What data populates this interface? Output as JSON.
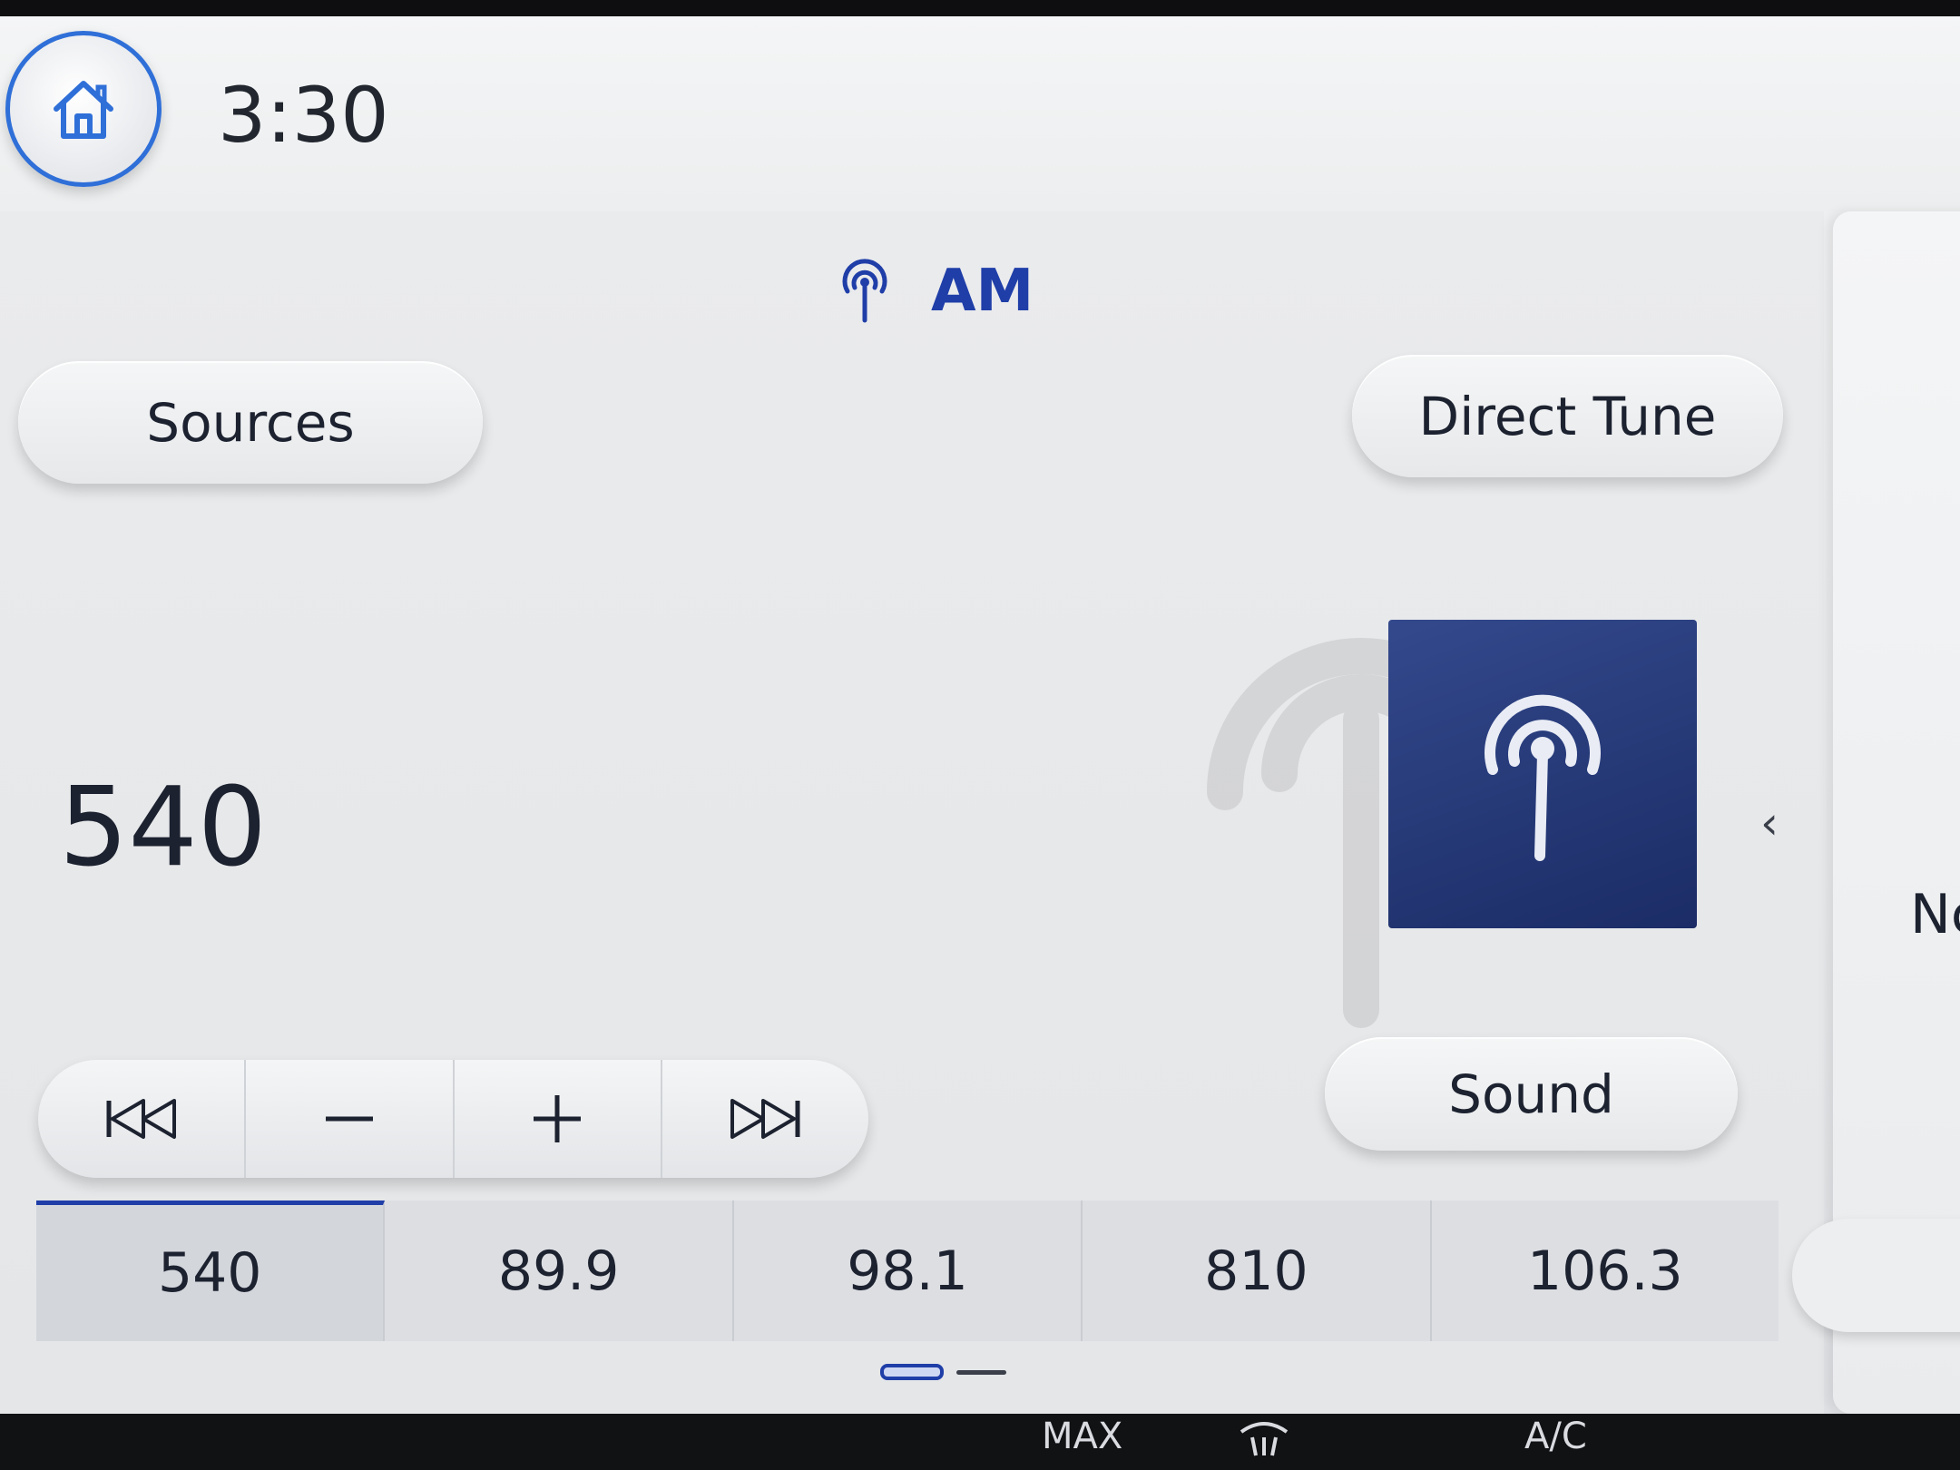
{
  "header": {
    "home_icon": "home-icon",
    "clock": "3:30"
  },
  "source": {
    "icon": "radio-antenna-icon",
    "band": "AM"
  },
  "buttons": {
    "sources": "Sources",
    "direct_tune": "Direct Tune",
    "sound": "Sound"
  },
  "station": {
    "frequency": "540"
  },
  "transport": {
    "seek_back_icon": "seek-back-icon",
    "tune_down_icon": "minus-icon",
    "tune_up_icon": "plus-icon",
    "seek_forward_icon": "seek-forward-icon"
  },
  "presets": [
    {
      "label": "540",
      "active": true
    },
    {
      "label": "89.9",
      "active": false
    },
    {
      "label": "98.1",
      "active": false
    },
    {
      "label": "810",
      "active": false
    },
    {
      "label": "106.3",
      "active": false
    }
  ],
  "pager": {
    "pages": 2,
    "current": 1
  },
  "side_panel": {
    "chevron": "‹",
    "text": "Nc"
  },
  "climate": {
    "max_label": "MAX",
    "ac_label": "A/C"
  },
  "colors": {
    "accent": "#1f3ea8",
    "art_bg": "#2a3e7e"
  }
}
